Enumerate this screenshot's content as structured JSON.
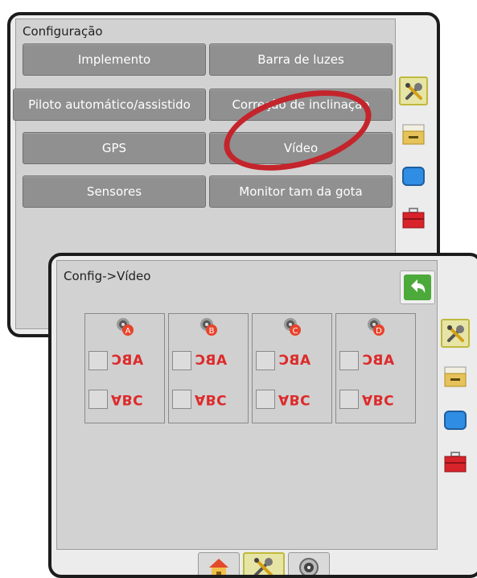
{
  "config_menu": {
    "title": "Configuração",
    "buttons": [
      "Implemento",
      "Barra de luzes",
      "Piloto automático/assistido",
      "Correção de inclinação",
      "GPS",
      "Vídeo",
      "Sensores",
      "Monitor tam da gota"
    ],
    "side_icons": [
      "tools-icon",
      "console-icon",
      "screen-icon",
      "toolbox-icon"
    ],
    "highlight_color": "#c4242b"
  },
  "video_panel": {
    "title": "Config->Vídeo",
    "cameras": [
      {
        "letter": "A",
        "badge_color": "#e8432b"
      },
      {
        "letter": "B",
        "badge_color": "#e8432b"
      },
      {
        "letter": "C",
        "badge_color": "#e8432b"
      },
      {
        "letter": "D",
        "badge_color": "#e8432b"
      }
    ],
    "option_top": "ABC",
    "option_bottom": "ABC",
    "side_icons": [
      "tools-icon",
      "console-icon",
      "screen-icon",
      "toolbox-icon"
    ],
    "bottom_tabs": [
      "home-icon",
      "tools-icon",
      "camera-lens-icon"
    ]
  }
}
